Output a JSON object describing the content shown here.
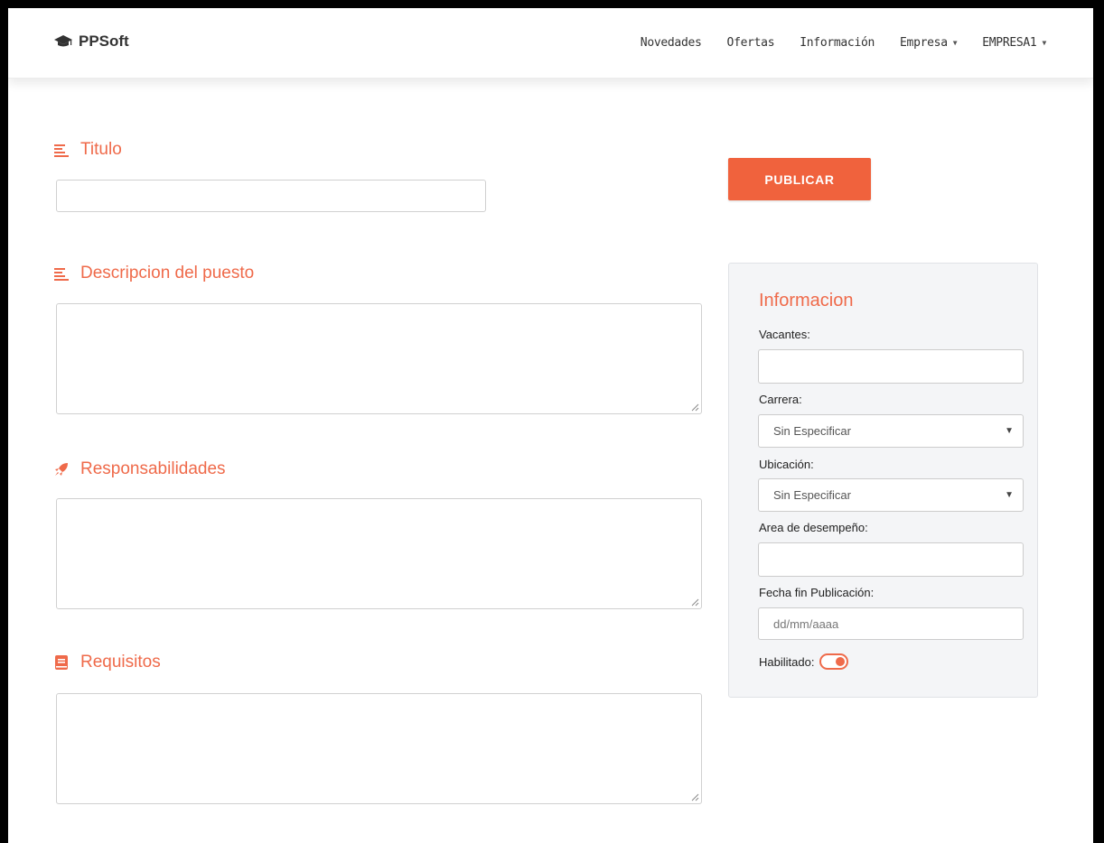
{
  "navbar": {
    "brand": "PPSoft",
    "brand_icon": "graduation-cap-icon",
    "links": [
      {
        "label": "Novedades"
      },
      {
        "label": "Ofertas"
      },
      {
        "label": "Información"
      },
      {
        "label": "Empresa",
        "dropdown": true
      },
      {
        "label": "EMPRESA1",
        "dropdown": true
      }
    ]
  },
  "form": {
    "titulo": {
      "label": "Titulo",
      "icon": "align-left-icon",
      "value": ""
    },
    "descripcion": {
      "label": "Descripcion del puesto",
      "icon": "align-left-icon",
      "value": ""
    },
    "responsabilidades": {
      "label": "Responsabilidades",
      "icon": "rocket-icon",
      "value": ""
    },
    "requisitos": {
      "label": "Requisitos",
      "icon": "book-icon",
      "value": ""
    }
  },
  "publish_button": {
    "label": "PUBLICAR"
  },
  "info_panel": {
    "title": "Informacion",
    "vacantes": {
      "label": "Vacantes:",
      "value": ""
    },
    "carrera": {
      "label": "Carrera:",
      "selected": "Sin Especificar"
    },
    "ubicacion": {
      "label": "Ubicación:",
      "selected": "Sin Especificar"
    },
    "area": {
      "label": "Area de desempeño:",
      "value": ""
    },
    "fecha": {
      "label": "Fecha fin Publicación:",
      "placeholder": "dd/mm/aaaa"
    },
    "habilitado": {
      "label": "Habilitado:",
      "enabled": true
    }
  },
  "colors": {
    "accent": "#ef6a4a",
    "button": "#f0623d",
    "panel_bg": "#f4f5f7"
  }
}
